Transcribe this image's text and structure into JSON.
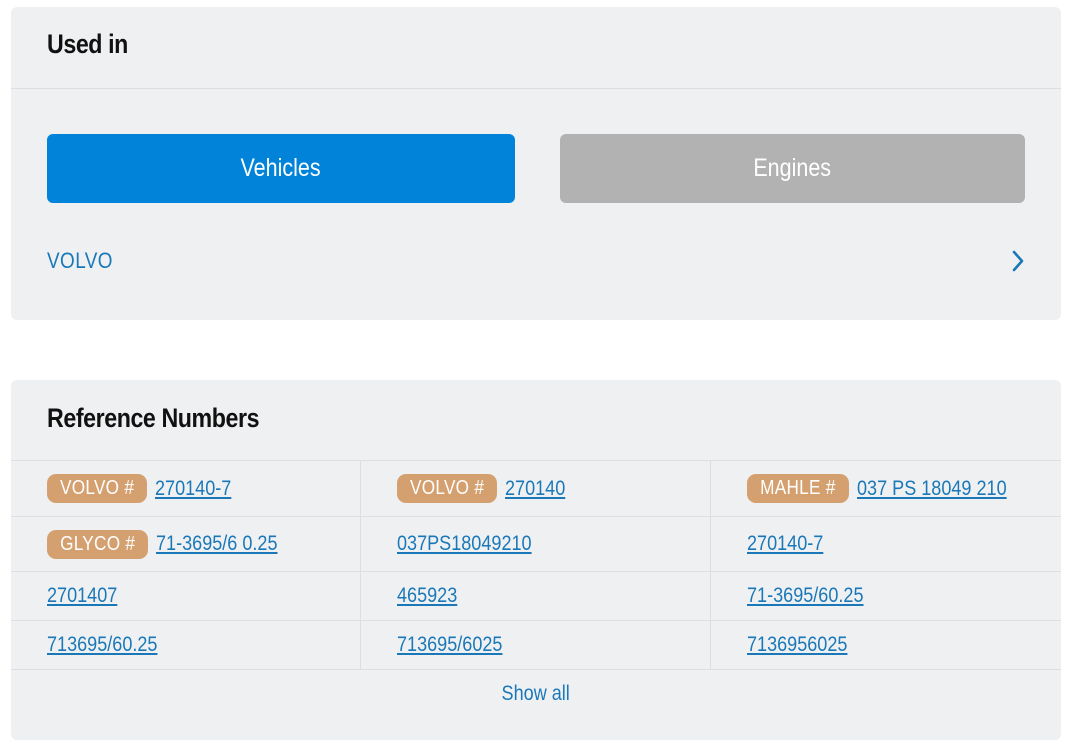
{
  "used_in": {
    "title": "Used in",
    "tabs": {
      "vehicles": "Vehicles",
      "engines": "Engines",
      "active": "vehicles"
    },
    "makes": [
      {
        "label": "VOLVO"
      }
    ]
  },
  "reference_numbers": {
    "title": "Reference Numbers",
    "rows": [
      [
        {
          "badge": "VOLVO #",
          "number": "270140-7"
        },
        {
          "badge": "VOLVO #",
          "number": "270140"
        },
        {
          "badge": "MAHLE #",
          "number": "037 PS 18049 210"
        }
      ],
      [
        {
          "badge": "GLYCO #",
          "number": "71-3695/6 0.25"
        },
        {
          "number": "037PS18049210"
        },
        {
          "number": "270140-7"
        }
      ],
      [
        {
          "number": "2701407"
        },
        {
          "number": "465923"
        },
        {
          "number": "71-3695/60.25"
        }
      ],
      [
        {
          "number": "713695/60.25"
        },
        {
          "number": "713695/6025"
        },
        {
          "number": "7136956025"
        }
      ]
    ],
    "show_all": "Show all"
  },
  "colors": {
    "primary": "#0083d9",
    "inactive_tab": "#b2b2b2",
    "link": "#1a78b8",
    "badge": "#d5a06f",
    "card_bg": "#eff0f2"
  },
  "icons": {
    "make_row": "chevron-right-icon"
  }
}
